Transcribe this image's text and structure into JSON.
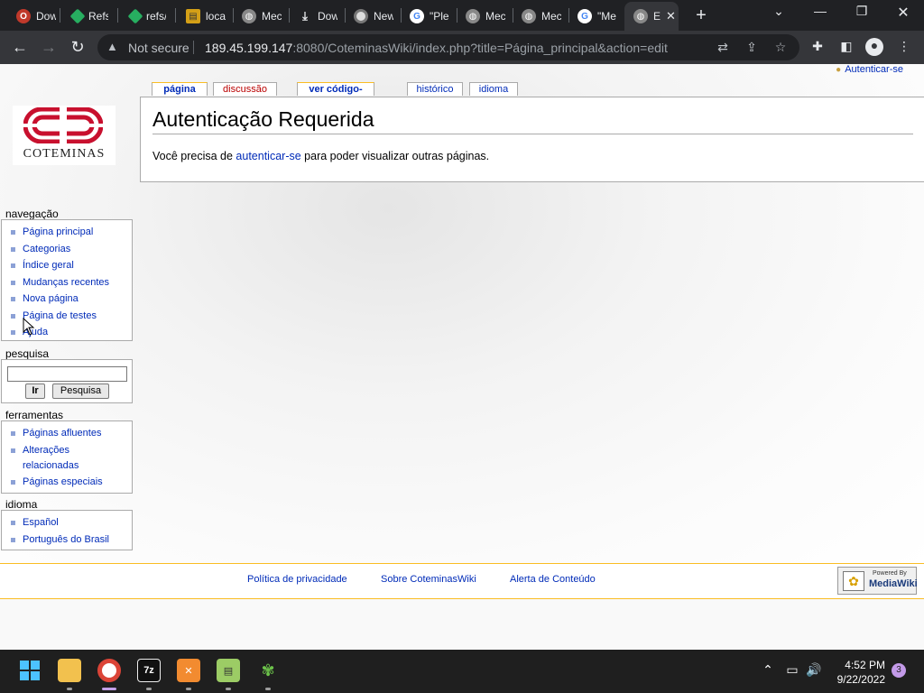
{
  "browser": {
    "tabs": [
      {
        "label": "Dow",
        "icon": "opera-icon",
        "color": "#c0392b"
      },
      {
        "label": "Refs",
        "icon": "git-icon",
        "color": "#27ae60"
      },
      {
        "label": "refs/",
        "icon": "git-icon",
        "color": "#27ae60"
      },
      {
        "label": "loca",
        "icon": "db-icon",
        "color": "#d4a017"
      },
      {
        "label": "Mec",
        "icon": "globe-icon",
        "color": "#888"
      },
      {
        "label": "Dow",
        "icon": "download-icon",
        "color": "#e8eaed"
      },
      {
        "label": "New",
        "icon": "chrome-icon",
        "color": "#bbb"
      },
      {
        "label": "\"Ple",
        "icon": "google-icon",
        "color": "#4285f4"
      },
      {
        "label": "Mec",
        "icon": "globe-icon",
        "color": "#888"
      },
      {
        "label": "Mec",
        "icon": "globe-icon",
        "color": "#888"
      },
      {
        "label": "\"Me",
        "icon": "google-icon",
        "color": "#4285f4"
      },
      {
        "label": "E",
        "icon": "globe-icon",
        "color": "#888"
      }
    ],
    "not_secure": "Not secure",
    "url_host": "189.45.199.147",
    "url_rest": ":8080/CoteminasWiki/index.php?title=Página_principal&action=edit"
  },
  "wiki": {
    "login_link": "Autenticar-se",
    "tabs": {
      "page": "página",
      "discussion": "discussão",
      "view_source": "ver código-fonte",
      "history": "histórico",
      "language": "idioma"
    },
    "heading": "Autenticação Requerida",
    "body_prefix": "Você precisa de ",
    "body_link": "autenticar-se",
    "body_suffix": " para poder visualizar outras páginas.",
    "logo_text": "COTEMINAS",
    "logo_color": "#c8102e",
    "navigation": {
      "title": "navegação",
      "items": [
        "Página principal",
        "Categorias",
        "Índice geral",
        "Mudanças recentes",
        "Nova página",
        "Página de testes",
        "Ajuda"
      ]
    },
    "search": {
      "title": "pesquisa",
      "value": "",
      "go_label": "Ir",
      "search_label": "Pesquisa"
    },
    "tools": {
      "title": "ferramentas",
      "items": [
        "Páginas afluentes",
        "Alterações relacionadas",
        "Páginas especiais"
      ]
    },
    "languages": {
      "title": "idioma",
      "items": [
        "Español",
        "Português do Brasil"
      ]
    },
    "footer": {
      "privacy": "Política de privacidade",
      "about": "Sobre CoteminasWiki",
      "disclaimer": "Alerta de Conteúdo",
      "powered_small": "Powered By",
      "powered_big": "MediaWiki"
    }
  },
  "taskbar": {
    "time": "4:52 PM",
    "date": "9/22/2022",
    "notifications": "3"
  }
}
